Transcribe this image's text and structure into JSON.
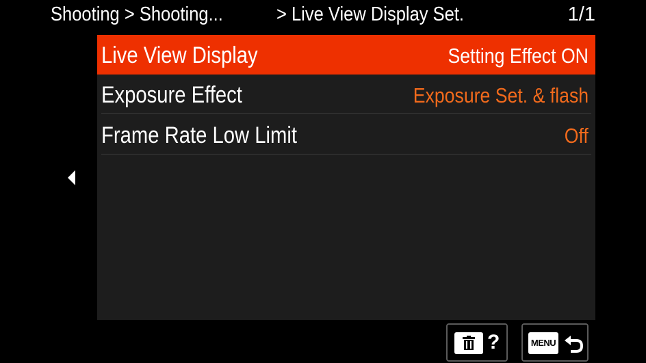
{
  "header": {
    "breadcrumb_1": "Shooting > Shooting...",
    "breadcrumb_2": "> Live View Display Set.",
    "page_indicator": "1/1"
  },
  "menu": {
    "items": [
      {
        "label": "Live View Display",
        "value": "Setting Effect ON",
        "selected": true
      },
      {
        "label": "Exposure Effect",
        "value": "Exposure Set. & flash",
        "selected": false
      },
      {
        "label": "Frame Rate Low Limit",
        "value": "Off",
        "selected": false
      }
    ]
  },
  "footer": {
    "help_symbol": "?",
    "menu_label": "MENU",
    "delete_icon": "trash-icon",
    "back_icon": "return-arrow-icon"
  },
  "colors": {
    "selected_row": "#ee3000",
    "value_text": "#f26a1c",
    "panel": "#1d1d1d",
    "background": "#000000"
  }
}
